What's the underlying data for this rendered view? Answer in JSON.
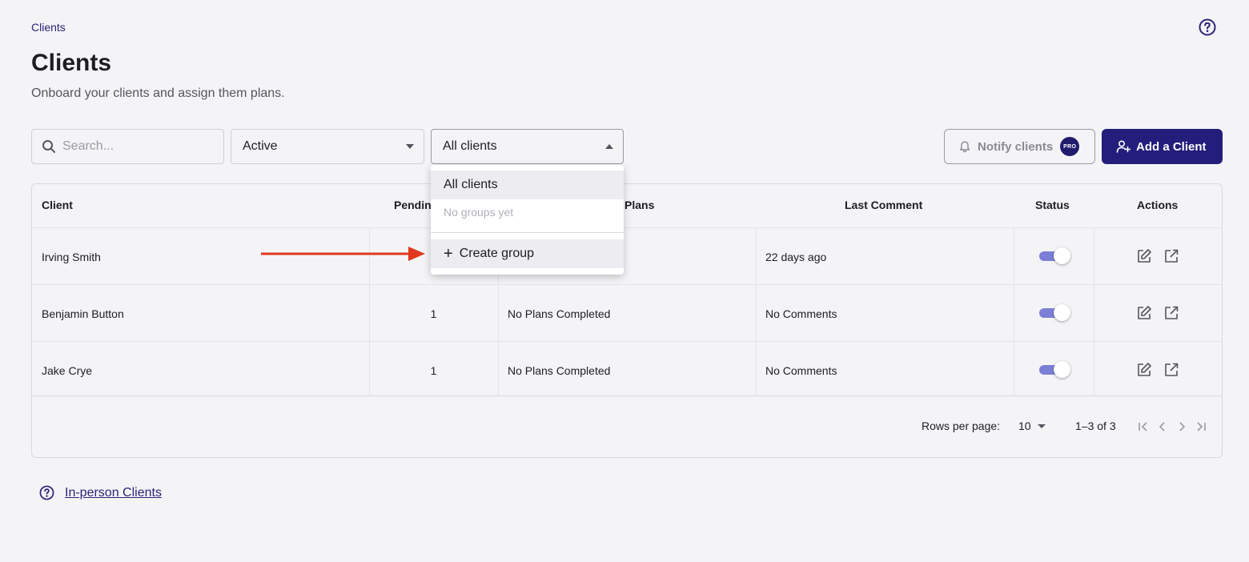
{
  "breadcrumb": "Clients",
  "header": {
    "title": "Clients",
    "subtitle": "Onboard your clients and assign them plans."
  },
  "toolbar": {
    "search_placeholder": "Search...",
    "status_filter": "Active",
    "group_filter": "All clients",
    "notify_label": "Notify clients",
    "pro_badge": "PRO",
    "add_label": "Add a Client"
  },
  "table": {
    "columns": {
      "client": "Client",
      "pending": "Pendin",
      "plans": "Plans",
      "last_comment": "Last Comment",
      "status": "Status",
      "actions": "Actions"
    },
    "rows": [
      {
        "client": "Irving Smith",
        "pending": "",
        "plans": "",
        "last_comment": "22 days ago",
        "status_on": true
      },
      {
        "client": "Benjamin Button",
        "pending": "1",
        "plans": "No Plans Completed",
        "last_comment": "No Comments",
        "status_on": true
      },
      {
        "client": "Jake Crye",
        "pending": "1",
        "plans": "No Plans Completed",
        "last_comment": "No Comments",
        "status_on": true
      }
    ]
  },
  "pagination": {
    "rows_per_page_label": "Rows per page:",
    "rows_per_page_value": "10",
    "range": "1–3 of 3"
  },
  "dropdown": {
    "options": [
      "All clients"
    ],
    "empty_text": "No groups yet",
    "create_label": "Create group"
  },
  "footer": {
    "link_label": "In-person Clients"
  },
  "colors": {
    "brand": "#231d7c",
    "toggle": "#7b7fd6",
    "annotation_arrow": "#e0391f"
  }
}
